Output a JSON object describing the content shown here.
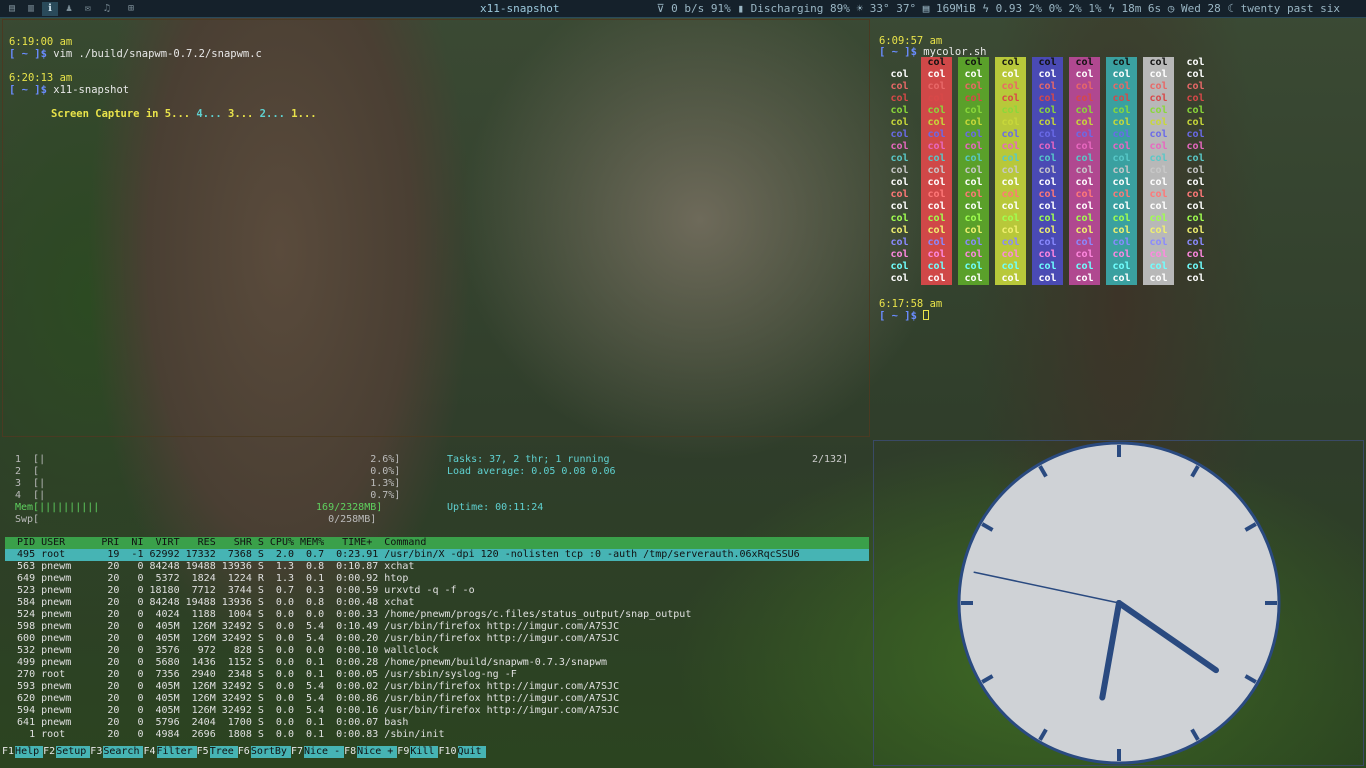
{
  "bar": {
    "workspaces": [
      "▤",
      "▥",
      "ℹ",
      "♟",
      "✉",
      "♫"
    ],
    "grid_icon": "⊞",
    "title": "x11-snapshot",
    "status": "⊽ 0 b/s 91% ▮ Discharging 89% ☀ 33° 37° ▤ 169MiB ϟ 0.93 2% 0% 2% 1% ϟ 18m 6s ◷ Wed 28 ☾ twenty past six"
  },
  "term1": {
    "l1": "6:19:00 am",
    "l2a": "[ ~ ]$ ",
    "l2b": "vim ./build/snapwm-0.7.2/snapwm.c",
    "l3": "6:20:13 am",
    "l4a": "[ ~ ]$ ",
    "l4b": "x11-snapshot",
    "cap_a": "Screen Capture in ",
    "cap_5": "5...",
    "cap_4": "4...",
    "cap_3": "3...",
    "cap_2": "2...",
    "cap_1": "1..."
  },
  "term2": {
    "t1": "6:09:57 am",
    "p1a": "[ ~ ]$ ",
    "p1b": "mycolor.sh",
    "t2": "6:17:58 am",
    "p2a": "[ ~ ]$ ",
    "cell": "col",
    "bgs": [
      "transparent",
      "#d04848",
      "#5aa02a",
      "#b8c83a",
      "#4a4ab4",
      "#b04890",
      "#3aa0a0",
      "#b8b8b8",
      "transparent"
    ],
    "fgs": [
      "#ffffff",
      "#e86868",
      "#d84848",
      "#8ad83a",
      "#c8d83a",
      "#6a6ae8",
      "#e868c0",
      "#58c8c8",
      "#c8c8c8",
      "#ffffff",
      "#ff7878",
      "#ffffff",
      "#a0ff50",
      "#f0f070",
      "#8a8aff",
      "#ff88e0",
      "#70ffff",
      "#ffffff"
    ]
  },
  "htop": {
    "cpu1": "1  [|                                                      2.6%]",
    "cpu2": "2  [                                                       0.0%]",
    "cpu3": "3  [|                                                      1.3%]",
    "cpu4": "4  [|                                                      0.7%]",
    "mem": "Mem[||||||||||                                    169/2328MB]",
    "swp": "Swp[                                                0/258MB]",
    "tasks": "Tasks: 37, 2 thr; 1 running",
    "tasks_r": "2/132]",
    "load": "Load average: 0.05 0.08 0.06",
    "uptime": "Uptime: 00:11:24",
    "header": "  PID USER      PRI  NI  VIRT   RES   SHR S CPU% MEM%   TIME+  Command",
    "rows": [
      "  495 root       19  -1 62992 17332  7368 S  2.0  0.7  0:23.91 /usr/bin/X -dpi 120 -nolisten tcp :0 -auth /tmp/serverauth.06xRqcSSU6",
      "  563 pnewm      20   0 84248 19488 13936 S  1.3  0.8  0:10.87 xchat",
      "  649 pnewm      20   0  5372  1824  1224 R  1.3  0.1  0:00.92 htop",
      "  523 pnewm      20   0 18180  7712  3744 S  0.7  0.3  0:00.59 urxvtd -q -f -o",
      "  584 pnewm      20   0 84248 19488 13936 S  0.0  0.8  0:00.48 xchat",
      "  524 pnewm      20   0  4024  1188  1004 S  0.0  0.0  0:00.33 /home/pnewm/progs/c.files/status_output/snap_output",
      "  598 pnewm      20   0  405M  126M 32492 S  0.0  5.4  0:10.49 /usr/bin/firefox http://imgur.com/A7SJC",
      "  600 pnewm      20   0  405M  126M 32492 S  0.0  5.4  0:00.20 /usr/bin/firefox http://imgur.com/A7SJC",
      "  532 pnewm      20   0  3576   972   828 S  0.0  0.0  0:00.10 wallclock",
      "  499 pnewm      20   0  5680  1436  1152 S  0.0  0.1  0:00.28 /home/pnewm/build/snapwm-0.7.3/snapwm",
      "  270 root       20   0  7356  2940  2348 S  0.0  0.1  0:00.05 /usr/sbin/syslog-ng -F",
      "  593 pnewm      20   0  405M  126M 32492 S  0.0  5.4  0:00.02 /usr/bin/firefox http://imgur.com/A7SJC",
      "  620 pnewm      20   0  405M  126M 32492 S  0.0  5.4  0:00.86 /usr/bin/firefox http://imgur.com/A7SJC",
      "  594 pnewm      20   0  405M  126M 32492 S  0.0  5.4  0:00.16 /usr/bin/firefox http://imgur.com/A7SJC",
      "  641 pnewm      20   0  5796  2404  1700 S  0.0  0.1  0:00.07 bash",
      "    1 root       20   0  4984  2696  1808 S  0.0  0.1  0:00.83 /sbin/init"
    ],
    "fkeys": [
      [
        "F1",
        "Help"
      ],
      [
        "F2",
        "Setup"
      ],
      [
        "F3",
        "Search"
      ],
      [
        "F4",
        "Filter"
      ],
      [
        "F5",
        "Tree"
      ],
      [
        "F6",
        "SortBy"
      ],
      [
        "F7",
        "Nice -"
      ],
      [
        "F8",
        "Nice +"
      ],
      [
        "F9",
        "Kill"
      ],
      [
        "F10",
        "Quit"
      ]
    ]
  },
  "clock": {
    "hour": 6,
    "minute": 20,
    "second": 47
  }
}
